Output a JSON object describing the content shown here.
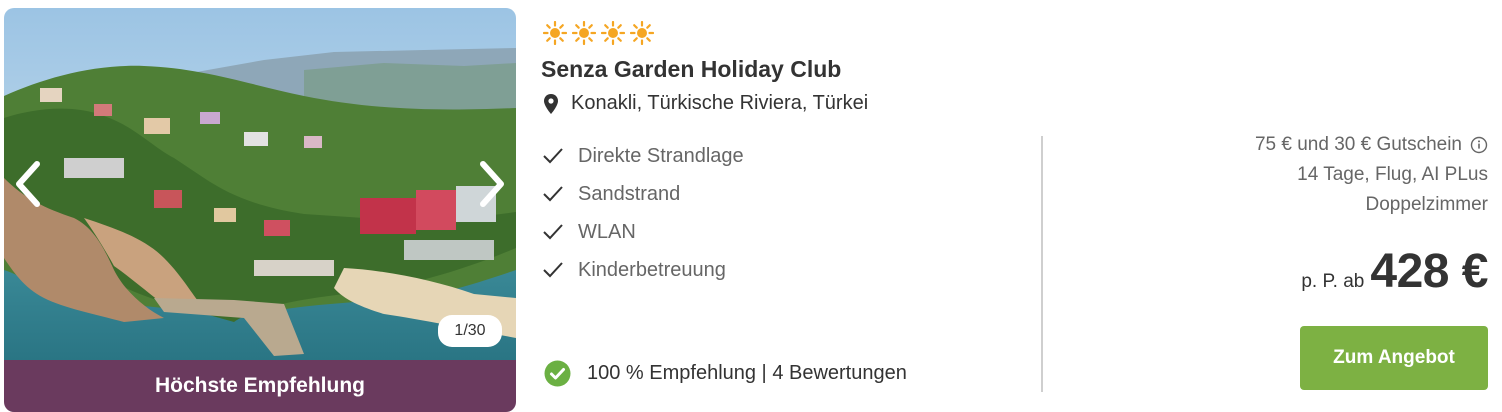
{
  "gallery": {
    "counter": "1/30",
    "ribbon_label": "Höchste Empfehlung",
    "prev_icon": "chevron-left-icon",
    "next_icon": "chevron-right-icon"
  },
  "hotel": {
    "star_count": 4,
    "star_icon": "sun-icon",
    "star_color": "#f5a623",
    "name": "Senza Garden Holiday Club",
    "location": "Konakli, Türkische Riviera, Türkei",
    "features": [
      "Direkte Strandlage",
      "Sandstrand",
      "WLAN",
      "Kinderbetreuung"
    ],
    "rating_text": "100 % Empfehlung | 4 Bewertungen",
    "rating_icon_color": "#6bb043"
  },
  "offer": {
    "voucher": "75 € und 30 € Gutschein",
    "duration": "14 Tage, Flug, AI PLus",
    "room": "Doppelzimmer",
    "price_prefix": "p. P. ab",
    "price": "428 €",
    "cta_label": "Zum Angebot",
    "cta_color": "#7db143"
  },
  "colors": {
    "ribbon": "#6a3a5e",
    "text": "#333333",
    "muted": "#666666"
  }
}
